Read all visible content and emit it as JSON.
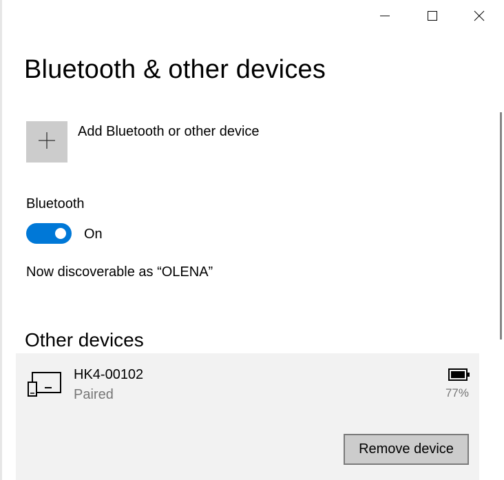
{
  "window": {
    "controls": {
      "minimize_icon": "minimize-icon",
      "maximize_icon": "maximize-icon",
      "close_icon": "close-icon"
    }
  },
  "page": {
    "title": "Bluetooth & other devices"
  },
  "add_device": {
    "icon": "plus-icon",
    "label": "Add Bluetooth or other device"
  },
  "bluetooth": {
    "label": "Bluetooth",
    "toggle_on": true,
    "toggle_state_label": "On",
    "discoverable_text": "Now discoverable as “OLENA”"
  },
  "other_devices": {
    "heading": "Other devices",
    "devices": [
      {
        "icon": "device-icon",
        "name": "HK4-00102",
        "status": "Paired",
        "battery_icon": "battery-icon",
        "battery_percent": "77%",
        "remove_label": "Remove device"
      }
    ]
  },
  "colors": {
    "accent": "#0078d7",
    "tile_background": "#cccccc",
    "card_background": "#f2f2f2",
    "secondary_text": "#767676"
  }
}
